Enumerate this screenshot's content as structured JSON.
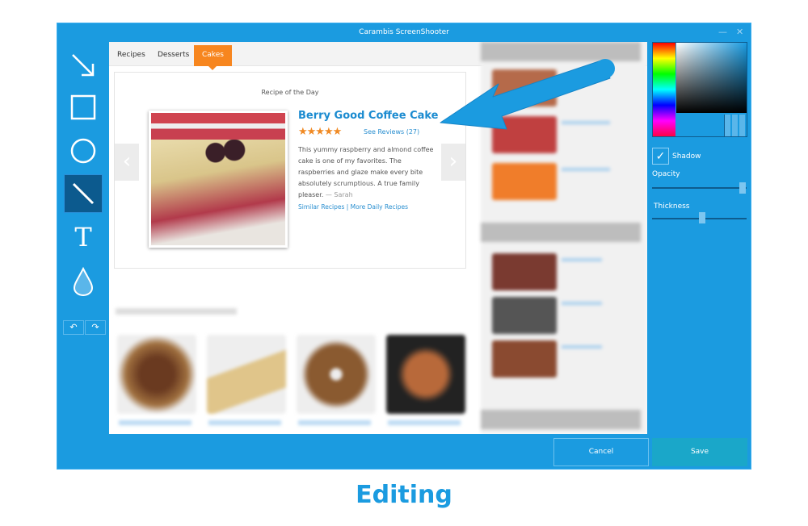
{
  "window": {
    "title": "Carambis ScreenShooter",
    "minimize_icon": "minimize-icon",
    "close_icon": "close-icon"
  },
  "tools": [
    {
      "name": "arrow-tool",
      "icon": "arrow-icon"
    },
    {
      "name": "rectangle-tool",
      "icon": "square-icon"
    },
    {
      "name": "ellipse-tool",
      "icon": "circle-icon"
    },
    {
      "name": "line-tool",
      "icon": "line-icon",
      "selected": true
    },
    {
      "name": "text-tool",
      "icon": "text-icon",
      "glyph": "T"
    },
    {
      "name": "blur-tool",
      "icon": "drop-icon"
    }
  ],
  "history": {
    "undo": "↶",
    "redo": "↷"
  },
  "page": {
    "tabs": [
      {
        "label": "Recipes"
      },
      {
        "label": "Desserts"
      },
      {
        "label": "Cakes",
        "active": true
      }
    ],
    "recipe_of_day": {
      "heading": "Recipe of the Day",
      "name": "Berry Good Coffee Cake",
      "stars": "★★★★★",
      "rating": 4.5,
      "reviews": "See Reviews (27)",
      "description": "This yummy raspberry and almond coffee cake is one of my favorites. The raspberries and glaze make every bite absolutely scrumptious. A true family pleaser.",
      "author": "— Sarah",
      "links": "Similar Recipes | More Daily Recipes",
      "prev": "‹",
      "next": "›"
    }
  },
  "panel": {
    "shadow_label": "Shadow",
    "shadow_checked": true,
    "opacity_label": "Opacity",
    "opacity_value": 0.95,
    "thickness_label": "Thickness",
    "thickness_value": 0.5,
    "selected_color": "#1b9be0"
  },
  "buttons": {
    "cancel": "Cancel",
    "save": "Save"
  },
  "caption": "Editing",
  "colors": {
    "accent": "#1b9be0",
    "tab_active": "#f7861f",
    "save_bg": "#1aa7c9"
  }
}
